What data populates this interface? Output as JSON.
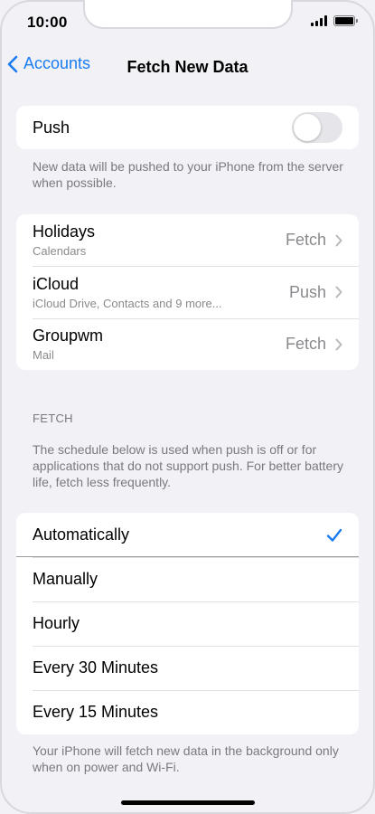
{
  "status_bar": {
    "time": "10:00"
  },
  "nav": {
    "back_label": "Accounts",
    "title": "Fetch New Data"
  },
  "push": {
    "label": "Push",
    "enabled": false,
    "footnote": "New data will be pushed to your iPhone from the server when possible."
  },
  "accounts": [
    {
      "name": "Holidays",
      "subtitle": "Calendars",
      "value": "Fetch"
    },
    {
      "name": "iCloud",
      "subtitle": "iCloud Drive, Contacts and 9 more...",
      "value": "Push"
    },
    {
      "name": "Groupwm",
      "subtitle": "Mail",
      "value": "Fetch"
    }
  ],
  "fetch": {
    "header": "FETCH",
    "description": "The schedule below is used when push is off or for applications that do not support push. For better battery life, fetch less frequently.",
    "options": [
      "Automatically",
      "Manually",
      "Hourly",
      "Every 30 Minutes",
      "Every 15 Minutes"
    ],
    "selected": "Automatically",
    "footnote": "Your iPhone will fetch new data in the background only when on power and Wi-Fi."
  },
  "colors": {
    "accent": "#1a7cf0",
    "background": "#f1f1f6",
    "secondary_text": "#8a8a8e"
  }
}
